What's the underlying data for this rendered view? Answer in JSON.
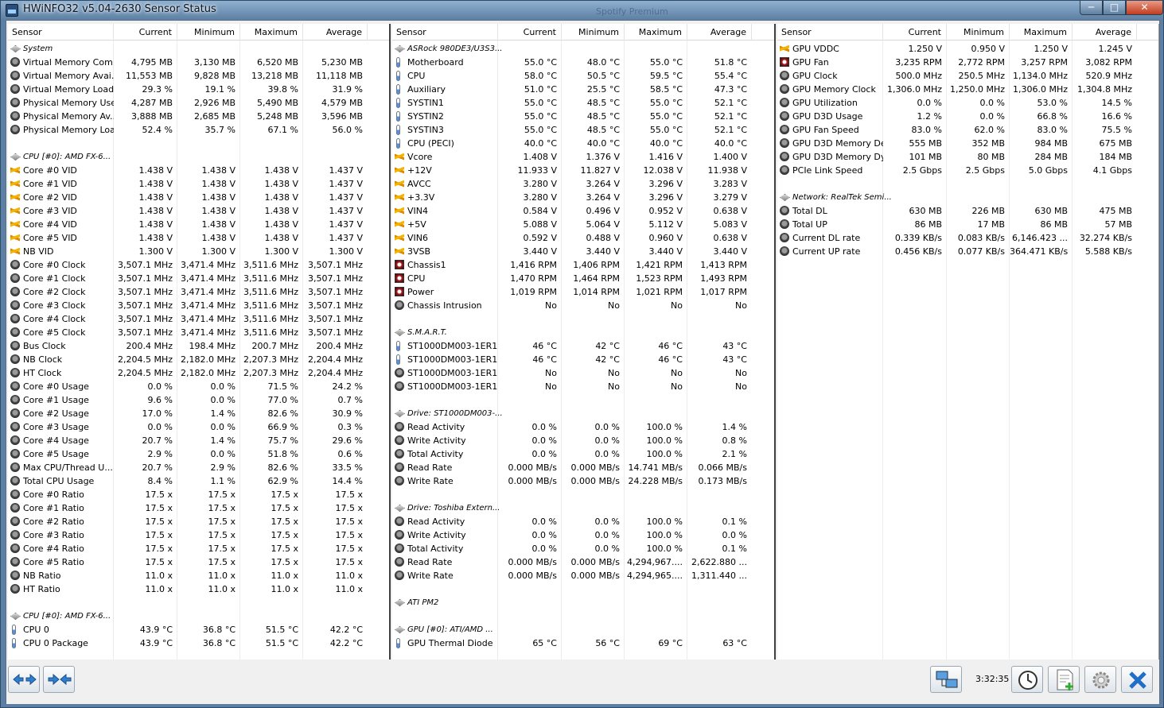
{
  "window": {
    "title": "HWiNFO32 v5.04-2630 Sensor Status",
    "background_title": "Spotify Premium",
    "close": "✕",
    "max": "□",
    "min": "─"
  },
  "columns": [
    "Sensor",
    "Current",
    "Minimum",
    "Maximum",
    "Average"
  ],
  "panels": [
    {
      "rows": [
        {
          "t": "group",
          "n": "System"
        },
        {
          "t": "sensor",
          "n": "Virtual Memory Com...",
          "v": [
            "4,795 MB",
            "3,130 MB",
            "6,520 MB",
            "5,230 MB"
          ]
        },
        {
          "t": "sensor",
          "n": "Virtual Memory Avai...",
          "v": [
            "11,553 MB",
            "9,828 MB",
            "13,218 MB",
            "11,118 MB"
          ]
        },
        {
          "t": "sensor",
          "n": "Virtual Memory Load",
          "v": [
            "29.3 %",
            "19.1 %",
            "39.8 %",
            "31.9 %"
          ]
        },
        {
          "t": "sensor",
          "n": "Physical Memory Used",
          "v": [
            "4,287 MB",
            "2,926 MB",
            "5,490 MB",
            "4,579 MB"
          ]
        },
        {
          "t": "sensor",
          "n": "Physical Memory Av...",
          "v": [
            "3,888 MB",
            "2,685 MB",
            "5,248 MB",
            "3,596 MB"
          ]
        },
        {
          "t": "sensor",
          "n": "Physical Memory Load",
          "v": [
            "52.4 %",
            "35.7 %",
            "67.1 %",
            "56.0 %"
          ]
        },
        {
          "t": "blank"
        },
        {
          "t": "group",
          "n": "CPU [#0]: AMD FX-6..."
        },
        {
          "t": "volt",
          "n": "Core #0 VID",
          "v": [
            "1.438 V",
            "1.438 V",
            "1.438 V",
            "1.437 V"
          ]
        },
        {
          "t": "volt",
          "n": "Core #1 VID",
          "v": [
            "1.438 V",
            "1.438 V",
            "1.438 V",
            "1.437 V"
          ]
        },
        {
          "t": "volt",
          "n": "Core #2 VID",
          "v": [
            "1.438 V",
            "1.438 V",
            "1.438 V",
            "1.437 V"
          ]
        },
        {
          "t": "volt",
          "n": "Core #3 VID",
          "v": [
            "1.438 V",
            "1.438 V",
            "1.438 V",
            "1.437 V"
          ]
        },
        {
          "t": "volt",
          "n": "Core #4 VID",
          "v": [
            "1.438 V",
            "1.438 V",
            "1.438 V",
            "1.437 V"
          ]
        },
        {
          "t": "volt",
          "n": "Core #5 VID",
          "v": [
            "1.438 V",
            "1.438 V",
            "1.438 V",
            "1.437 V"
          ]
        },
        {
          "t": "volt",
          "n": "NB VID",
          "v": [
            "1.300 V",
            "1.300 V",
            "1.300 V",
            "1.300 V"
          ]
        },
        {
          "t": "sensor",
          "n": "Core #0 Clock",
          "v": [
            "3,507.1 MHz",
            "3,471.4 MHz",
            "3,511.6 MHz",
            "3,507.1 MHz"
          ]
        },
        {
          "t": "sensor",
          "n": "Core #1 Clock",
          "v": [
            "3,507.1 MHz",
            "3,471.4 MHz",
            "3,511.6 MHz",
            "3,507.1 MHz"
          ]
        },
        {
          "t": "sensor",
          "n": "Core #2 Clock",
          "v": [
            "3,507.1 MHz",
            "3,471.4 MHz",
            "3,511.6 MHz",
            "3,507.1 MHz"
          ]
        },
        {
          "t": "sensor",
          "n": "Core #3 Clock",
          "v": [
            "3,507.1 MHz",
            "3,471.4 MHz",
            "3,511.6 MHz",
            "3,507.1 MHz"
          ]
        },
        {
          "t": "sensor",
          "n": "Core #4 Clock",
          "v": [
            "3,507.1 MHz",
            "3,471.4 MHz",
            "3,511.6 MHz",
            "3,507.1 MHz"
          ]
        },
        {
          "t": "sensor",
          "n": "Core #5 Clock",
          "v": [
            "3,507.1 MHz",
            "3,471.4 MHz",
            "3,511.6 MHz",
            "3,507.1 MHz"
          ]
        },
        {
          "t": "sensor",
          "n": "Bus Clock",
          "v": [
            "200.4 MHz",
            "198.4 MHz",
            "200.7 MHz",
            "200.4 MHz"
          ]
        },
        {
          "t": "sensor",
          "n": "NB Clock",
          "v": [
            "2,204.5 MHz",
            "2,182.0 MHz",
            "2,207.3 MHz",
            "2,204.4 MHz"
          ]
        },
        {
          "t": "sensor",
          "n": "HT Clock",
          "v": [
            "2,204.5 MHz",
            "2,182.0 MHz",
            "2,207.3 MHz",
            "2,204.4 MHz"
          ]
        },
        {
          "t": "sensor",
          "n": "Core #0 Usage",
          "v": [
            "0.0 %",
            "0.0 %",
            "71.5 %",
            "24.2 %"
          ]
        },
        {
          "t": "sensor",
          "n": "Core #1 Usage",
          "v": [
            "9.6 %",
            "0.0 %",
            "77.0 %",
            "0.7 %"
          ]
        },
        {
          "t": "sensor",
          "n": "Core #2 Usage",
          "v": [
            "17.0 %",
            "1.4 %",
            "82.6 %",
            "30.9 %"
          ]
        },
        {
          "t": "sensor",
          "n": "Core #3 Usage",
          "v": [
            "0.0 %",
            "0.0 %",
            "66.9 %",
            "0.3 %"
          ]
        },
        {
          "t": "sensor",
          "n": "Core #4 Usage",
          "v": [
            "20.7 %",
            "1.4 %",
            "75.7 %",
            "29.6 %"
          ]
        },
        {
          "t": "sensor",
          "n": "Core #5 Usage",
          "v": [
            "2.9 %",
            "0.0 %",
            "51.8 %",
            "0.6 %"
          ]
        },
        {
          "t": "sensor",
          "n": "Max CPU/Thread U...",
          "v": [
            "20.7 %",
            "2.9 %",
            "82.6 %",
            "33.5 %"
          ]
        },
        {
          "t": "sensor",
          "n": "Total CPU Usage",
          "v": [
            "8.4 %",
            "1.1 %",
            "62.9 %",
            "14.4 %"
          ]
        },
        {
          "t": "sensor",
          "n": "Core #0 Ratio",
          "v": [
            "17.5 x",
            "17.5 x",
            "17.5 x",
            "17.5 x"
          ]
        },
        {
          "t": "sensor",
          "n": "Core #1 Ratio",
          "v": [
            "17.5 x",
            "17.5 x",
            "17.5 x",
            "17.5 x"
          ]
        },
        {
          "t": "sensor",
          "n": "Core #2 Ratio",
          "v": [
            "17.5 x",
            "17.5 x",
            "17.5 x",
            "17.5 x"
          ]
        },
        {
          "t": "sensor",
          "n": "Core #3 Ratio",
          "v": [
            "17.5 x",
            "17.5 x",
            "17.5 x",
            "17.5 x"
          ]
        },
        {
          "t": "sensor",
          "n": "Core #4 Ratio",
          "v": [
            "17.5 x",
            "17.5 x",
            "17.5 x",
            "17.5 x"
          ]
        },
        {
          "t": "sensor",
          "n": "Core #5 Ratio",
          "v": [
            "17.5 x",
            "17.5 x",
            "17.5 x",
            "17.5 x"
          ]
        },
        {
          "t": "sensor",
          "n": "NB Ratio",
          "v": [
            "11.0 x",
            "11.0 x",
            "11.0 x",
            "11.0 x"
          ]
        },
        {
          "t": "sensor",
          "n": "HT Ratio",
          "v": [
            "11.0 x",
            "11.0 x",
            "11.0 x",
            "11.0 x"
          ]
        },
        {
          "t": "blank"
        },
        {
          "t": "group",
          "n": "CPU [#0]: AMD FX-6..."
        },
        {
          "t": "temp",
          "n": "CPU 0",
          "v": [
            "43.9 °C",
            "36.8 °C",
            "51.5 °C",
            "42.2 °C"
          ]
        },
        {
          "t": "temp",
          "n": "CPU 0 Package",
          "v": [
            "43.9 °C",
            "36.8 °C",
            "51.5 °C",
            "42.2 °C"
          ]
        }
      ]
    },
    {
      "rows": [
        {
          "t": "group",
          "n": "ASRock 980DE3/U3S3..."
        },
        {
          "t": "temp",
          "n": "Motherboard",
          "v": [
            "55.0 °C",
            "48.0 °C",
            "55.0 °C",
            "51.8 °C"
          ]
        },
        {
          "t": "temp",
          "n": "CPU",
          "v": [
            "58.0 °C",
            "50.5 °C",
            "59.5 °C",
            "55.4 °C"
          ]
        },
        {
          "t": "temp",
          "n": "Auxiliary",
          "v": [
            "51.0 °C",
            "25.5 °C",
            "58.5 °C",
            "47.3 °C"
          ]
        },
        {
          "t": "temp",
          "n": "SYSTIN1",
          "v": [
            "55.0 °C",
            "48.5 °C",
            "55.0 °C",
            "52.1 °C"
          ]
        },
        {
          "t": "temp",
          "n": "SYSTIN2",
          "v": [
            "55.0 °C",
            "48.5 °C",
            "55.0 °C",
            "52.1 °C"
          ]
        },
        {
          "t": "temp",
          "n": "SYSTIN3",
          "v": [
            "55.0 °C",
            "48.5 °C",
            "55.0 °C",
            "52.1 °C"
          ]
        },
        {
          "t": "temp",
          "n": "CPU (PECI)",
          "v": [
            "40.0 °C",
            "40.0 °C",
            "40.0 °C",
            "40.0 °C"
          ]
        },
        {
          "t": "volt",
          "n": "Vcore",
          "v": [
            "1.408 V",
            "1.376 V",
            "1.416 V",
            "1.400 V"
          ]
        },
        {
          "t": "volt",
          "n": "+12V",
          "v": [
            "11.933 V",
            "11.827 V",
            "12.038 V",
            "11.938 V"
          ]
        },
        {
          "t": "volt",
          "n": "AVCC",
          "v": [
            "3.280 V",
            "3.264 V",
            "3.296 V",
            "3.283 V"
          ]
        },
        {
          "t": "volt",
          "n": "+3.3V",
          "v": [
            "3.280 V",
            "3.264 V",
            "3.296 V",
            "3.279 V"
          ]
        },
        {
          "t": "volt",
          "n": "VIN4",
          "v": [
            "0.584 V",
            "0.496 V",
            "0.952 V",
            "0.638 V"
          ]
        },
        {
          "t": "volt",
          "n": "+5V",
          "v": [
            "5.088 V",
            "5.064 V",
            "5.112 V",
            "5.083 V"
          ]
        },
        {
          "t": "volt",
          "n": "VIN6",
          "v": [
            "0.592 V",
            "0.488 V",
            "0.960 V",
            "0.638 V"
          ]
        },
        {
          "t": "volt",
          "n": "3VSB",
          "v": [
            "3.440 V",
            "3.440 V",
            "3.440 V",
            "3.440 V"
          ]
        },
        {
          "t": "fan",
          "n": "Chassis1",
          "v": [
            "1,416 RPM",
            "1,406 RPM",
            "1,421 RPM",
            "1,413 RPM"
          ]
        },
        {
          "t": "fan",
          "n": "CPU",
          "v": [
            "1,470 RPM",
            "1,464 RPM",
            "1,523 RPM",
            "1,493 RPM"
          ]
        },
        {
          "t": "fan",
          "n": "Power",
          "v": [
            "1,019 RPM",
            "1,014 RPM",
            "1,021 RPM",
            "1,017 RPM"
          ]
        },
        {
          "t": "sensor",
          "n": "Chassis Intrusion",
          "v": [
            "No",
            "No",
            "No",
            "No"
          ]
        },
        {
          "t": "blank"
        },
        {
          "t": "group",
          "n": "S.M.A.R.T."
        },
        {
          "t": "temp",
          "n": "ST1000DM003-1ER1...",
          "v": [
            "46 °C",
            "42 °C",
            "46 °C",
            "43 °C"
          ]
        },
        {
          "t": "temp",
          "n": "ST1000DM003-1ER1...",
          "v": [
            "46 °C",
            "42 °C",
            "46 °C",
            "43 °C"
          ]
        },
        {
          "t": "sensor",
          "n": "ST1000DM003-1ER1...",
          "v": [
            "No",
            "No",
            "No",
            "No"
          ]
        },
        {
          "t": "sensor",
          "n": "ST1000DM003-1ER1...",
          "v": [
            "No",
            "No",
            "No",
            "No"
          ]
        },
        {
          "t": "blank"
        },
        {
          "t": "group",
          "n": "Drive: ST1000DM003-..."
        },
        {
          "t": "sensor",
          "n": "Read Activity",
          "v": [
            "0.0 %",
            "0.0 %",
            "100.0 %",
            "1.4 %"
          ]
        },
        {
          "t": "sensor",
          "n": "Write Activity",
          "v": [
            "0.0 %",
            "0.0 %",
            "100.0 %",
            "0.8 %"
          ]
        },
        {
          "t": "sensor",
          "n": "Total Activity",
          "v": [
            "0.0 %",
            "0.0 %",
            "100.0 %",
            "2.1 %"
          ]
        },
        {
          "t": "sensor",
          "n": "Read Rate",
          "v": [
            "0.000 MB/s",
            "0.000 MB/s",
            "14.741 MB/s",
            "0.066 MB/s"
          ]
        },
        {
          "t": "sensor",
          "n": "Write Rate",
          "v": [
            "0.000 MB/s",
            "0.000 MB/s",
            "24.228 MB/s",
            "0.173 MB/s"
          ]
        },
        {
          "t": "blank"
        },
        {
          "t": "group",
          "n": "Drive: Toshiba Extern..."
        },
        {
          "t": "sensor",
          "n": "Read Activity",
          "v": [
            "0.0 %",
            "0.0 %",
            "100.0 %",
            "0.1 %"
          ]
        },
        {
          "t": "sensor",
          "n": "Write Activity",
          "v": [
            "0.0 %",
            "0.0 %",
            "100.0 %",
            "0.0 %"
          ]
        },
        {
          "t": "sensor",
          "n": "Total Activity",
          "v": [
            "0.0 %",
            "0.0 %",
            "100.0 %",
            "0.1 %"
          ]
        },
        {
          "t": "sensor",
          "n": "Read Rate",
          "v": [
            "0.000 MB/s",
            "0.000 MB/s",
            "4,294,967....",
            "2,622.880 ..."
          ]
        },
        {
          "t": "sensor",
          "n": "Write Rate",
          "v": [
            "0.000 MB/s",
            "0.000 MB/s",
            "4,294,965....",
            "1,311.440 ..."
          ]
        },
        {
          "t": "blank"
        },
        {
          "t": "group",
          "n": "ATI PM2"
        },
        {
          "t": "blank"
        },
        {
          "t": "group",
          "n": "GPU [#0]: ATI/AMD ..."
        },
        {
          "t": "temp",
          "n": "GPU Thermal Diode",
          "v": [
            "65 °C",
            "56 °C",
            "69 °C",
            "63 °C"
          ]
        }
      ]
    },
    {
      "rows": [
        {
          "t": "volt",
          "n": "GPU VDDC",
          "v": [
            "1.250 V",
            "0.950 V",
            "1.250 V",
            "1.245 V"
          ]
        },
        {
          "t": "fan",
          "n": "GPU Fan",
          "v": [
            "3,235 RPM",
            "2,772 RPM",
            "3,257 RPM",
            "3,082 RPM"
          ]
        },
        {
          "t": "sensor",
          "n": "GPU Clock",
          "v": [
            "500.0 MHz",
            "250.5 MHz",
            "1,134.0 MHz",
            "520.9 MHz"
          ]
        },
        {
          "t": "sensor",
          "n": "GPU Memory Clock",
          "v": [
            "1,306.0 MHz",
            "1,250.0 MHz",
            "1,306.0 MHz",
            "1,304.8 MHz"
          ]
        },
        {
          "t": "sensor",
          "n": "GPU Utilization",
          "v": [
            "0.0 %",
            "0.0 %",
            "53.0 %",
            "14.5 %"
          ]
        },
        {
          "t": "sensor",
          "n": "GPU D3D Usage",
          "v": [
            "1.2 %",
            "0.0 %",
            "66.8 %",
            "16.6 %"
          ]
        },
        {
          "t": "sensor",
          "n": "GPU Fan Speed",
          "v": [
            "83.0 %",
            "62.0 %",
            "83.0 %",
            "75.5 %"
          ]
        },
        {
          "t": "sensor",
          "n": "GPU D3D Memory De...",
          "v": [
            "555 MB",
            "352 MB",
            "984 MB",
            "675 MB"
          ]
        },
        {
          "t": "sensor",
          "n": "GPU D3D Memory Dy...",
          "v": [
            "101 MB",
            "80 MB",
            "284 MB",
            "184 MB"
          ]
        },
        {
          "t": "sensor",
          "n": "PCIe Link Speed",
          "v": [
            "2.5 Gbps",
            "2.5 Gbps",
            "5.0 Gbps",
            "4.1 Gbps"
          ]
        },
        {
          "t": "blank"
        },
        {
          "t": "group",
          "n": "Network: RealTek Semi..."
        },
        {
          "t": "sensor",
          "n": "Total DL",
          "v": [
            "630 MB",
            "226 MB",
            "630 MB",
            "475 MB"
          ]
        },
        {
          "t": "sensor",
          "n": "Total UP",
          "v": [
            "86 MB",
            "17 MB",
            "86 MB",
            "57 MB"
          ]
        },
        {
          "t": "sensor",
          "n": "Current DL rate",
          "v": [
            "0.339 KB/s",
            "0.083 KB/s",
            "6,146.423 ...",
            "32.274 KB/s"
          ]
        },
        {
          "t": "sensor",
          "n": "Current UP rate",
          "v": [
            "0.456 KB/s",
            "0.077 KB/s",
            "364.471 KB/s",
            "5.588 KB/s"
          ]
        }
      ]
    }
  ],
  "toolbar": {
    "clock": "3:32:35"
  }
}
